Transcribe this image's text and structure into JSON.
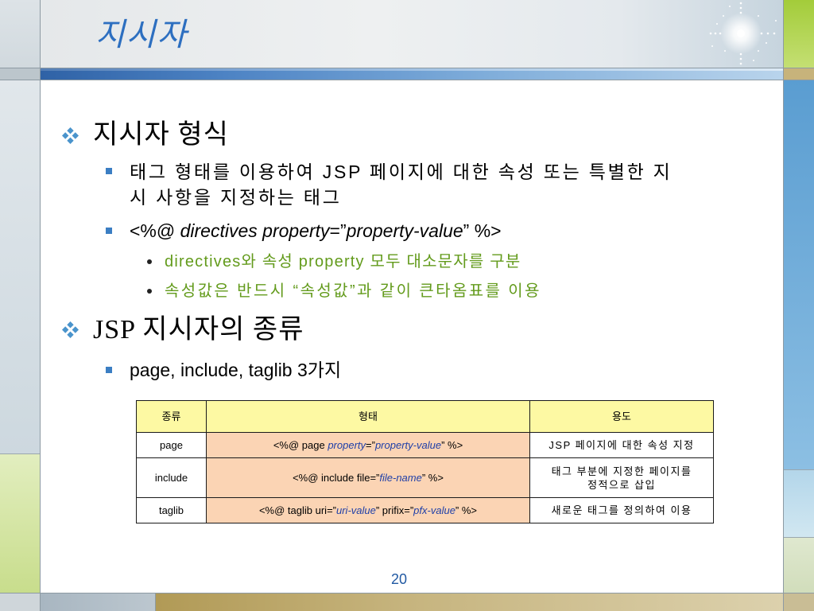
{
  "slide": {
    "title": "지시자",
    "page_number": "20"
  },
  "sections": [
    {
      "heading": "지시자 형식",
      "items": [
        {
          "lines": [
            "태그 형태를 이용하여 JSP 페이지에 대한 속성 또는 특별한 지",
            "시 사항을 지정하는 태그"
          ]
        },
        {
          "segments": [
            "<%@ ",
            "directives property",
            "=”",
            "property-value",
            "” %>"
          ],
          "subitems": [
            "directives와 속성 property 모두 대소문자를 구분",
            "속성값은 반드시 “속성값”과 같이 큰타옴표를 이용"
          ]
        }
      ]
    },
    {
      "heading": "JSP 지시자의 종류",
      "items": [
        {
          "text": "page, include, taglib 3가지"
        }
      ]
    }
  ],
  "table": {
    "headers": [
      "종류",
      "형태",
      "용도"
    ],
    "rows": [
      {
        "type": "page",
        "syntax": [
          "<%@ page ",
          "property",
          "=”",
          "property-value",
          "” %>"
        ],
        "usage": [
          "JSP 페이지에 대한 속성 지정"
        ]
      },
      {
        "type": "include",
        "syntax": [
          "<%@ include file=”",
          "file-name",
          "” %>"
        ],
        "usage": [
          "태그 부분에 지정한 페이지를",
          "정적으로 삽입"
        ]
      },
      {
        "type": "taglib",
        "syntax": [
          "<%@ taglib uri=”",
          "uri-value",
          "” prifix=”",
          "pfx-value",
          "” %>"
        ],
        "usage": [
          "새로운 태그를 정의하여 이용"
        ]
      }
    ]
  },
  "icons": {
    "section_bullet": "four-diamond-bullet",
    "item_bullet": "square-bullet",
    "subitem_bullet": "round-bullet",
    "decoration": "sparkle"
  },
  "colors": {
    "title": "#2d6fc0",
    "diamond_bullet": "#4a94cc",
    "bullet_blue": "#3b7ec3",
    "subitem_green": "#639b1c",
    "table_header_fill": "#fdf9a3",
    "table_syntax_fill": "#fbd4b4",
    "table_italic_blue": "#1f3fa8",
    "page_number": "#2159a3",
    "header_bar_dark": "#2f62a6",
    "header_bar_light": "#b9d4ec"
  }
}
